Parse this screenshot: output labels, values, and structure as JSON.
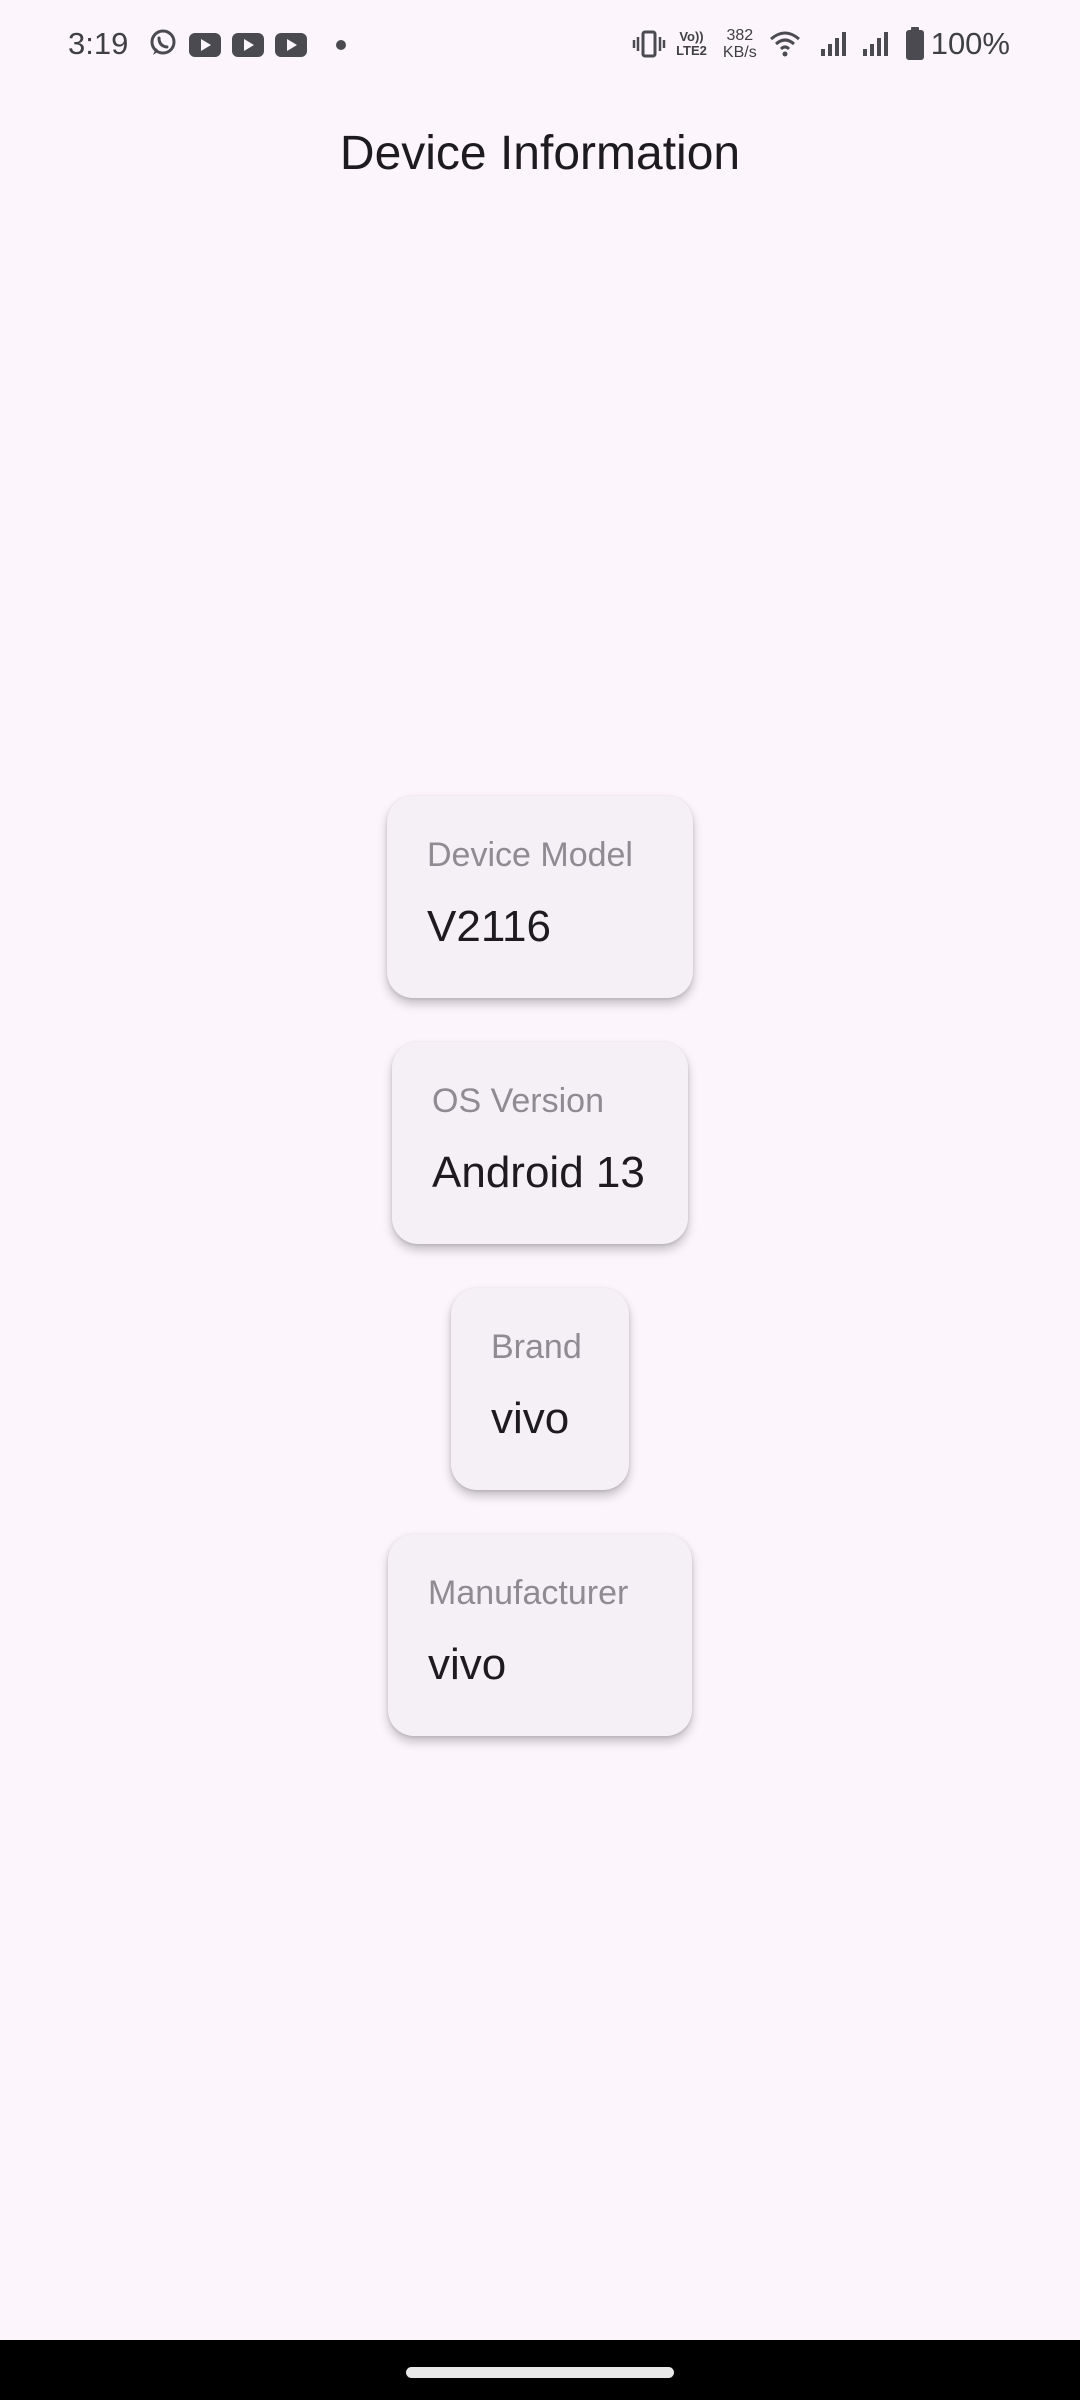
{
  "status_bar": {
    "time": "3:19",
    "left_icons": [
      "whatsapp-icon",
      "youtube-icon",
      "youtube-icon",
      "youtube-icon",
      "dot-icon"
    ],
    "volte_line1": "Vo))",
    "volte_line2": "LTE2",
    "net_speed_value": "382",
    "net_speed_unit": "KB/s",
    "battery_percent": "100%",
    "right_icons": [
      "vibrate-icon",
      "wifi-icon",
      "signal-icon",
      "signal-icon",
      "battery-icon"
    ]
  },
  "page": {
    "title": "Device Information"
  },
  "cards": [
    {
      "label": "Device Model",
      "value": "V2116"
    },
    {
      "label": "OS Version",
      "value": "Android 13"
    },
    {
      "label": "Brand",
      "value": "vivo"
    },
    {
      "label": "Manufacturer",
      "value": "vivo"
    }
  ],
  "colors": {
    "background": "#fcf6fc",
    "card_background": "#f4f0f6",
    "label_text": "#8e8b92",
    "value_text": "#1d1b20",
    "nav_bar": "#000000"
  }
}
